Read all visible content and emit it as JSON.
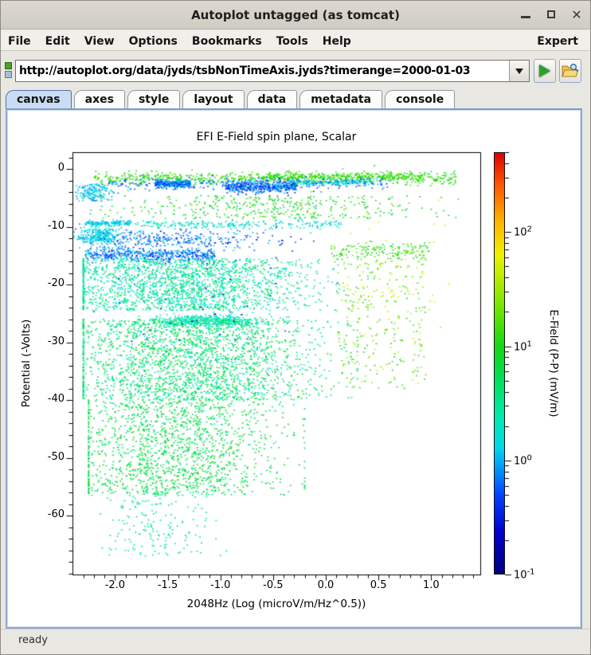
{
  "titlebar": {
    "title": "Autoplot untagged (as tomcat)"
  },
  "menubar": {
    "items": [
      "File",
      "Edit",
      "View",
      "Options",
      "Bookmarks",
      "Tools",
      "Help"
    ],
    "right_item": "Expert"
  },
  "toolbar": {
    "url_value": "http://autoplot.org/data/jyds/tsbNonTimeAxis.jyds?timerange=2000-01-03"
  },
  "tabs": {
    "selected": "canvas",
    "items": [
      "canvas",
      "axes",
      "style",
      "layout",
      "data",
      "metadata",
      "console"
    ]
  },
  "statusbar": {
    "text": "ready"
  },
  "chart_data": {
    "type": "scatter",
    "title": "EFI  E-Field spin plane, Scalar",
    "xlabel": "2048Hz (Log (microV/m/Hz^0.5))",
    "ylabel": "Potential (-Volts)",
    "colorbar_label": "E-Field (P-P) (mV/m)",
    "xlim": [
      -2.4,
      1.47
    ],
    "ylim": [
      -70.2,
      2.9
    ],
    "grid": false,
    "x_major_ticks": {
      "values": [
        -2.0,
        -1.5,
        -1.0,
        -0.5,
        0.0,
        0.5,
        1.0
      ],
      "labels": [
        "-2.0",
        "-1.5",
        "-1.0",
        "-0.5",
        "0.0",
        "0.5",
        "1.0"
      ]
    },
    "x_minor_step": 0.1,
    "y_major_ticks": {
      "values": [
        0,
        -10,
        -20,
        -30,
        -40,
        -50,
        -60
      ],
      "labels": [
        "0",
        "-10",
        "-20",
        "-30",
        "-40",
        "-50",
        "-60"
      ]
    },
    "y_minor_step": 2,
    "color_scale": {
      "type": "log",
      "range_log10": [
        -1,
        2.7
      ],
      "major_tick_exponents": [
        2,
        1,
        0,
        -1
      ]
    },
    "colormap_stops": [
      {
        "t": 0.0,
        "color": "#000080"
      },
      {
        "t": 0.1,
        "color": "#0000d0"
      },
      {
        "t": 0.19,
        "color": "#0046ff"
      },
      {
        "t": 0.26,
        "color": "#00a4f8"
      },
      {
        "t": 0.3,
        "color": "#00d8e8"
      },
      {
        "t": 0.37,
        "color": "#00e8b0"
      },
      {
        "t": 0.46,
        "color": "#00e05c"
      },
      {
        "t": 0.54,
        "color": "#14d814"
      },
      {
        "t": 0.62,
        "color": "#66e400"
      },
      {
        "t": 0.7,
        "color": "#b4ec00"
      },
      {
        "t": 0.76,
        "color": "#f0f000"
      },
      {
        "t": 0.84,
        "color": "#ffb000"
      },
      {
        "t": 0.92,
        "color": "#ff5c00"
      },
      {
        "t": 1.0,
        "color": "#e00000"
      }
    ],
    "seed": 42,
    "clusters": [
      {
        "name": "top-green-band",
        "count": 700,
        "x": {
          "dist": "uniform",
          "min": -2.2,
          "max": 1.25
        },
        "y": {
          "dist": "gauss",
          "mean": -1.6,
          "sd": 0.55
        },
        "c": [
          0.85,
          1.35
        ]
      },
      {
        "name": "top-green-dense",
        "count": 250,
        "x": {
          "dist": "uniform",
          "min": -0.6,
          "max": 0.9
        },
        "y": {
          "dist": "gauss",
          "mean": -1.3,
          "sd": 0.3
        },
        "c": [
          0.9,
          1.3
        ]
      },
      {
        "name": "top-blue-seg-1",
        "count": 260,
        "x": {
          "dist": "uniform",
          "min": -1.62,
          "max": -1.28
        },
        "y": {
          "dist": "gauss",
          "mean": -2.6,
          "sd": 0.35
        },
        "c": [
          -0.55,
          0.15
        ]
      },
      {
        "name": "top-blue-seg-2",
        "count": 420,
        "x": {
          "dist": "uniform",
          "min": -0.95,
          "max": -0.28
        },
        "y": {
          "dist": "gauss",
          "mean": -3.1,
          "sd": 0.5
        },
        "c": [
          -0.6,
          0.1
        ]
      },
      {
        "name": "top-cyan-seg",
        "count": 150,
        "x": {
          "dist": "uniform",
          "min": -0.35,
          "max": 0.45
        },
        "y": {
          "dist": "gauss",
          "mean": -2.3,
          "sd": 0.25
        },
        "c": [
          -0.1,
          0.35
        ]
      },
      {
        "name": "top-blue-scatter",
        "count": 300,
        "x": {
          "dist": "uniform",
          "min": -2.1,
          "max": 0.6
        },
        "y": {
          "dist": "gauss",
          "mean": -2.6,
          "sd": 0.55
        },
        "c": [
          -0.5,
          0.2
        ]
      },
      {
        "name": "left-cyan-hook",
        "count": 160,
        "x": {
          "dist": "gauss",
          "mean": -2.2,
          "sd": 0.08
        },
        "y": {
          "dist": "uniform",
          "min": -5.6,
          "max": -2.6
        },
        "c": [
          -0.15,
          0.3
        ]
      },
      {
        "name": "mid-green-scatter",
        "count": 380,
        "x": {
          "dist": "gauss",
          "mean": -0.5,
          "sd": 0.75
        },
        "y": {
          "dist": "uniform",
          "min": -8.6,
          "max": -4.6
        },
        "c": [
          0.7,
          1.25
        ]
      },
      {
        "name": "cyan-streak-left",
        "count": 150,
        "x": {
          "dist": "uniform",
          "min": -2.28,
          "max": -1.85
        },
        "y": {
          "dist": "gauss",
          "mean": -9.4,
          "sd": 0.25
        },
        "c": [
          -0.05,
          0.3
        ]
      },
      {
        "name": "cyan-line-9v",
        "count": 220,
        "x": {
          "dist": "uniform",
          "min": -1.85,
          "max": 0.15
        },
        "y": {
          "dist": "gauss",
          "mean": -9.6,
          "sd": 0.35
        },
        "c": [
          0.0,
          0.5
        ]
      },
      {
        "name": "cyan-blob-11v",
        "count": 260,
        "x": {
          "dist": "gauss",
          "mean": -2.15,
          "sd": 0.1
        },
        "y": {
          "dist": "gauss",
          "mean": -11.6,
          "sd": 0.8
        },
        "c": [
          -0.05,
          0.3
        ]
      },
      {
        "name": "blue-scatter-12v",
        "count": 320,
        "x": {
          "dist": "gauss",
          "mean": -1.5,
          "sd": 0.45
        },
        "y": {
          "dist": "gauss",
          "mean": -12.2,
          "sd": 0.9
        },
        "c": [
          -0.5,
          0.15
        ]
      },
      {
        "name": "blue-band-15v",
        "count": 480,
        "x": {
          "dist": "uniform",
          "min": -2.28,
          "max": -1.05
        },
        "y": {
          "dist": "gauss",
          "mean": -14.9,
          "sd": 0.55
        },
        "c": [
          -0.55,
          0.2
        ]
      },
      {
        "name": "green-right-14v",
        "count": 170,
        "x": {
          "dist": "uniform",
          "min": 0.05,
          "max": 1.0
        },
        "y": {
          "dist": "gauss",
          "mean": -14.3,
          "sd": 0.8
        },
        "c": [
          0.85,
          1.35
        ]
      },
      {
        "name": "upper-cloud",
        "count": 1900,
        "x": {
          "dist": "gauss",
          "mean": -1.35,
          "sd": 0.6,
          "min": -2.3,
          "max": 0.4
        },
        "y": {
          "dist": "uniform",
          "min": -24.5,
          "max": -15.5
        },
        "c": [
          0.1,
          0.75
        ]
      },
      {
        "name": "dense-cyan-26v",
        "count": 480,
        "x": {
          "dist": "gauss",
          "mean": -1.15,
          "sd": 0.3
        },
        "y": {
          "dist": "gauss",
          "mean": -26.3,
          "sd": 0.55
        },
        "c": [
          0.15,
          0.5
        ]
      },
      {
        "name": "mid-cloud",
        "count": 2300,
        "x": {
          "dist": "gauss",
          "mean": -1.25,
          "sd": 0.62,
          "min": -2.3,
          "max": 0.3
        },
        "y": {
          "dist": "uniform",
          "min": -40,
          "max": -26
        },
        "c": [
          0.25,
          0.95
        ]
      },
      {
        "name": "right-sparse",
        "count": 260,
        "x": {
          "dist": "uniform",
          "min": 0.1,
          "max": 0.95
        },
        "y": {
          "dist": "uniform",
          "min": -38,
          "max": -16
        },
        "c": [
          0.9,
          1.75
        ]
      },
      {
        "name": "lower-cloud",
        "count": 1500,
        "x": {
          "dist": "gauss",
          "mean": -1.45,
          "sd": 0.5,
          "min": -2.25,
          "max": -0.2
        },
        "y": {
          "dist": "uniform",
          "min": -56.5,
          "max": -40
        },
        "c": [
          0.45,
          1.05
        ]
      },
      {
        "name": "bottom-trail",
        "count": 170,
        "x": {
          "dist": "gauss",
          "mean": -1.6,
          "sd": 0.25
        },
        "y": {
          "dist": "uniform",
          "min": -67,
          "max": -56
        },
        "c": [
          0.25,
          0.7
        ]
      },
      {
        "name": "stray-yellow",
        "count": 40,
        "x": {
          "dist": "uniform",
          "min": 0.2,
          "max": 1.2
        },
        "y": {
          "dist": "uniform",
          "min": -35,
          "max": -4
        },
        "c": [
          1.55,
          1.95
        ]
      },
      {
        "name": "deep-blue-specks",
        "count": 60,
        "x": {
          "dist": "gauss",
          "mean": -1.3,
          "sd": 0.5
        },
        "y": {
          "dist": "uniform",
          "min": -30,
          "max": -10
        },
        "c": [
          -0.9,
          -0.4
        ]
      }
    ]
  }
}
